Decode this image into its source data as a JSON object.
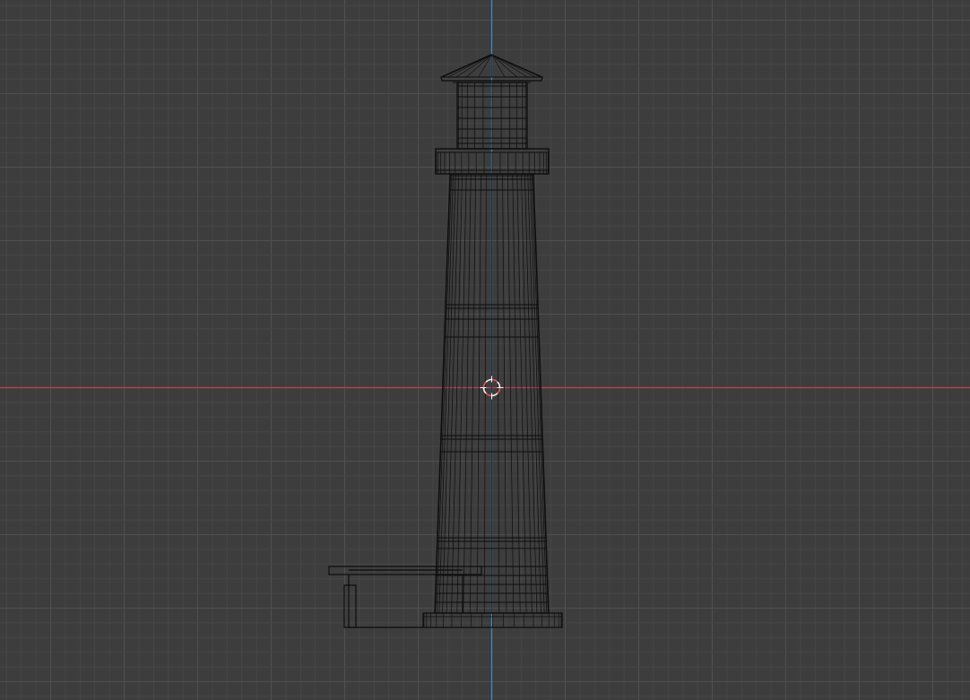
{
  "viewport": {
    "view": "front-orthographic",
    "shading": "wireframe",
    "colors": {
      "background": "#3d3d3d",
      "grid_minor": "#474747",
      "grid_major": "#505050",
      "x_axis": "#c0424f",
      "z_axis": "#3f8ec9",
      "wire": "#0d0d0d",
      "cursor_red": "#e85555",
      "cursor_white": "#f2f2f2"
    },
    "objects": [
      {
        "name": "lighthouse",
        "type": "mesh"
      },
      {
        "name": "keeper-house",
        "type": "mesh"
      }
    ],
    "icons": {
      "cursor": "3d-cursor-icon"
    }
  }
}
